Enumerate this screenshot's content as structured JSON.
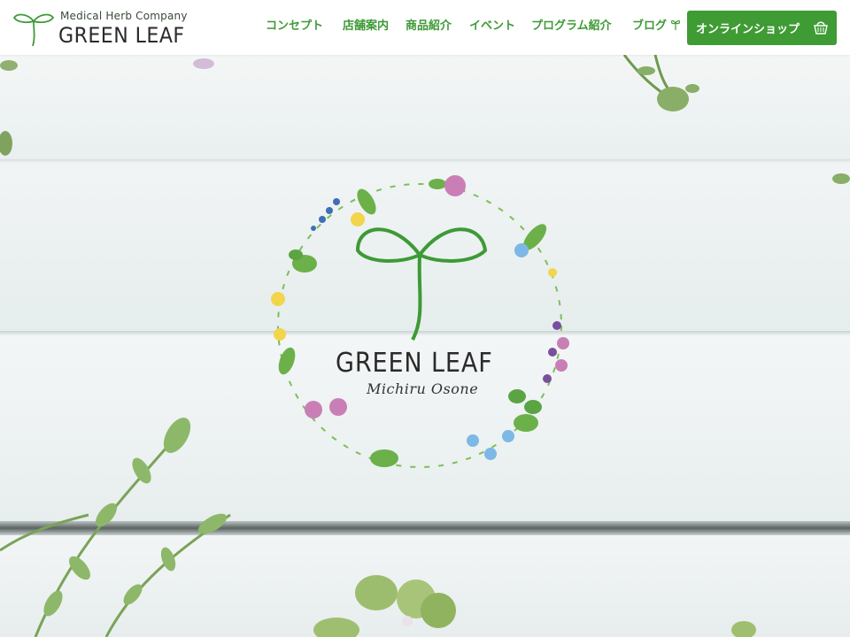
{
  "header": {
    "logo": {
      "tagline": "Medical Herb Company",
      "name": "GREEN LEAF"
    },
    "nav": [
      {
        "label": "コンセプト"
      },
      {
        "label": "店舗案内"
      },
      {
        "label": "商品紹介"
      },
      {
        "label": "イベント"
      },
      {
        "label": "プログラム紹介"
      },
      {
        "label": "ブログ"
      }
    ],
    "shop_button": {
      "label": "オンラインショップ",
      "icon": "basket-icon"
    }
  },
  "hero": {
    "wreath_logo": {
      "title": "GREEN LEAF",
      "signature": "Michiru Osone"
    }
  },
  "colors": {
    "brand_green": "#3d9a36",
    "button_green": "#3f9b34",
    "wood_white": "#eef2f2"
  }
}
